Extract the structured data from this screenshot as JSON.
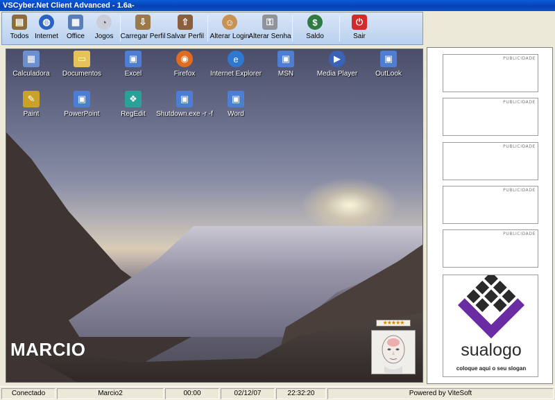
{
  "window": {
    "title": "VSCyber.Net Client Advanced - 1.6a-"
  },
  "toolbar": {
    "buttons": [
      {
        "label": "Todos",
        "icon": "all-programs-icon",
        "color": "#8a6d3b"
      },
      {
        "label": "Internet",
        "icon": "globe-icon",
        "color": "#2b63c5"
      },
      {
        "label": "Office",
        "icon": "office-icon",
        "color": "#5a7fb8"
      },
      {
        "label": "Jogos",
        "icon": "games-icon",
        "color": "#c9ced8"
      },
      {
        "label": "Carregar Perfil",
        "icon": "load-profile-icon",
        "color": "#9a7a48"
      },
      {
        "label": "Salvar Perfil",
        "icon": "save-profile-icon",
        "color": "#8b5e3c"
      },
      {
        "label": "Alterar Login",
        "icon": "user-icon",
        "color": "#c89254"
      },
      {
        "label": "Alterar Senha",
        "icon": "keys-icon",
        "color": "#8e939c"
      },
      {
        "label": "Saldo",
        "icon": "dollar-icon",
        "color": "#2f7b43"
      },
      {
        "label": "Sair",
        "icon": "power-icon",
        "color": "#d32a2a"
      }
    ]
  },
  "desktop": {
    "icons": [
      {
        "label": "Calculadora",
        "icon": "calculator-icon",
        "color": "#6b8fcf"
      },
      {
        "label": "Documentos",
        "icon": "folder-icon",
        "color": "#e6c35a"
      },
      {
        "label": "Excel",
        "icon": "computer-icon",
        "color": "#4d7ed3"
      },
      {
        "label": "Firefox",
        "icon": "firefox-icon",
        "color": "#e06c1f"
      },
      {
        "label": "Internet Explorer",
        "icon": "ie-icon",
        "color": "#2d78d1"
      },
      {
        "label": "MSN",
        "icon": "computer-icon",
        "color": "#4d7ed3"
      },
      {
        "label": "Media Player",
        "icon": "media-player-icon",
        "color": "#3a63b8"
      },
      {
        "label": "OutLook",
        "icon": "computer-icon",
        "color": "#4d7ed3"
      },
      {
        "label": "Paint",
        "icon": "paint-icon",
        "color": "#c9a227"
      },
      {
        "label": "PowerPoint",
        "icon": "computer-icon",
        "color": "#4d7ed3"
      },
      {
        "label": "RegEdit",
        "icon": "registry-icon",
        "color": "#2aa198"
      },
      {
        "label": "Shutdown.exe -r -f",
        "icon": "computer-icon",
        "color": "#4d7ed3"
      },
      {
        "label": "Word",
        "icon": "computer-icon",
        "color": "#4d7ed3"
      }
    ],
    "user_name": "MARCIO",
    "rating": "★★★★★"
  },
  "sidebar": {
    "ads": [
      "PUBLICIDADE",
      "PUBLICIDADE",
      "PUBLICIDADE",
      "PUBLICIDADE",
      "PUBLICIDADE"
    ],
    "logo_text": "sualogo",
    "logo_slogan": "coloque aqui o seu slogan"
  },
  "status": {
    "connection": "Conectado",
    "machine": "Marcio2",
    "time_used": "00:00",
    "date": "02/12/07",
    "clock": "22:32:20",
    "powered_by": "Powered by ViteSoft"
  }
}
